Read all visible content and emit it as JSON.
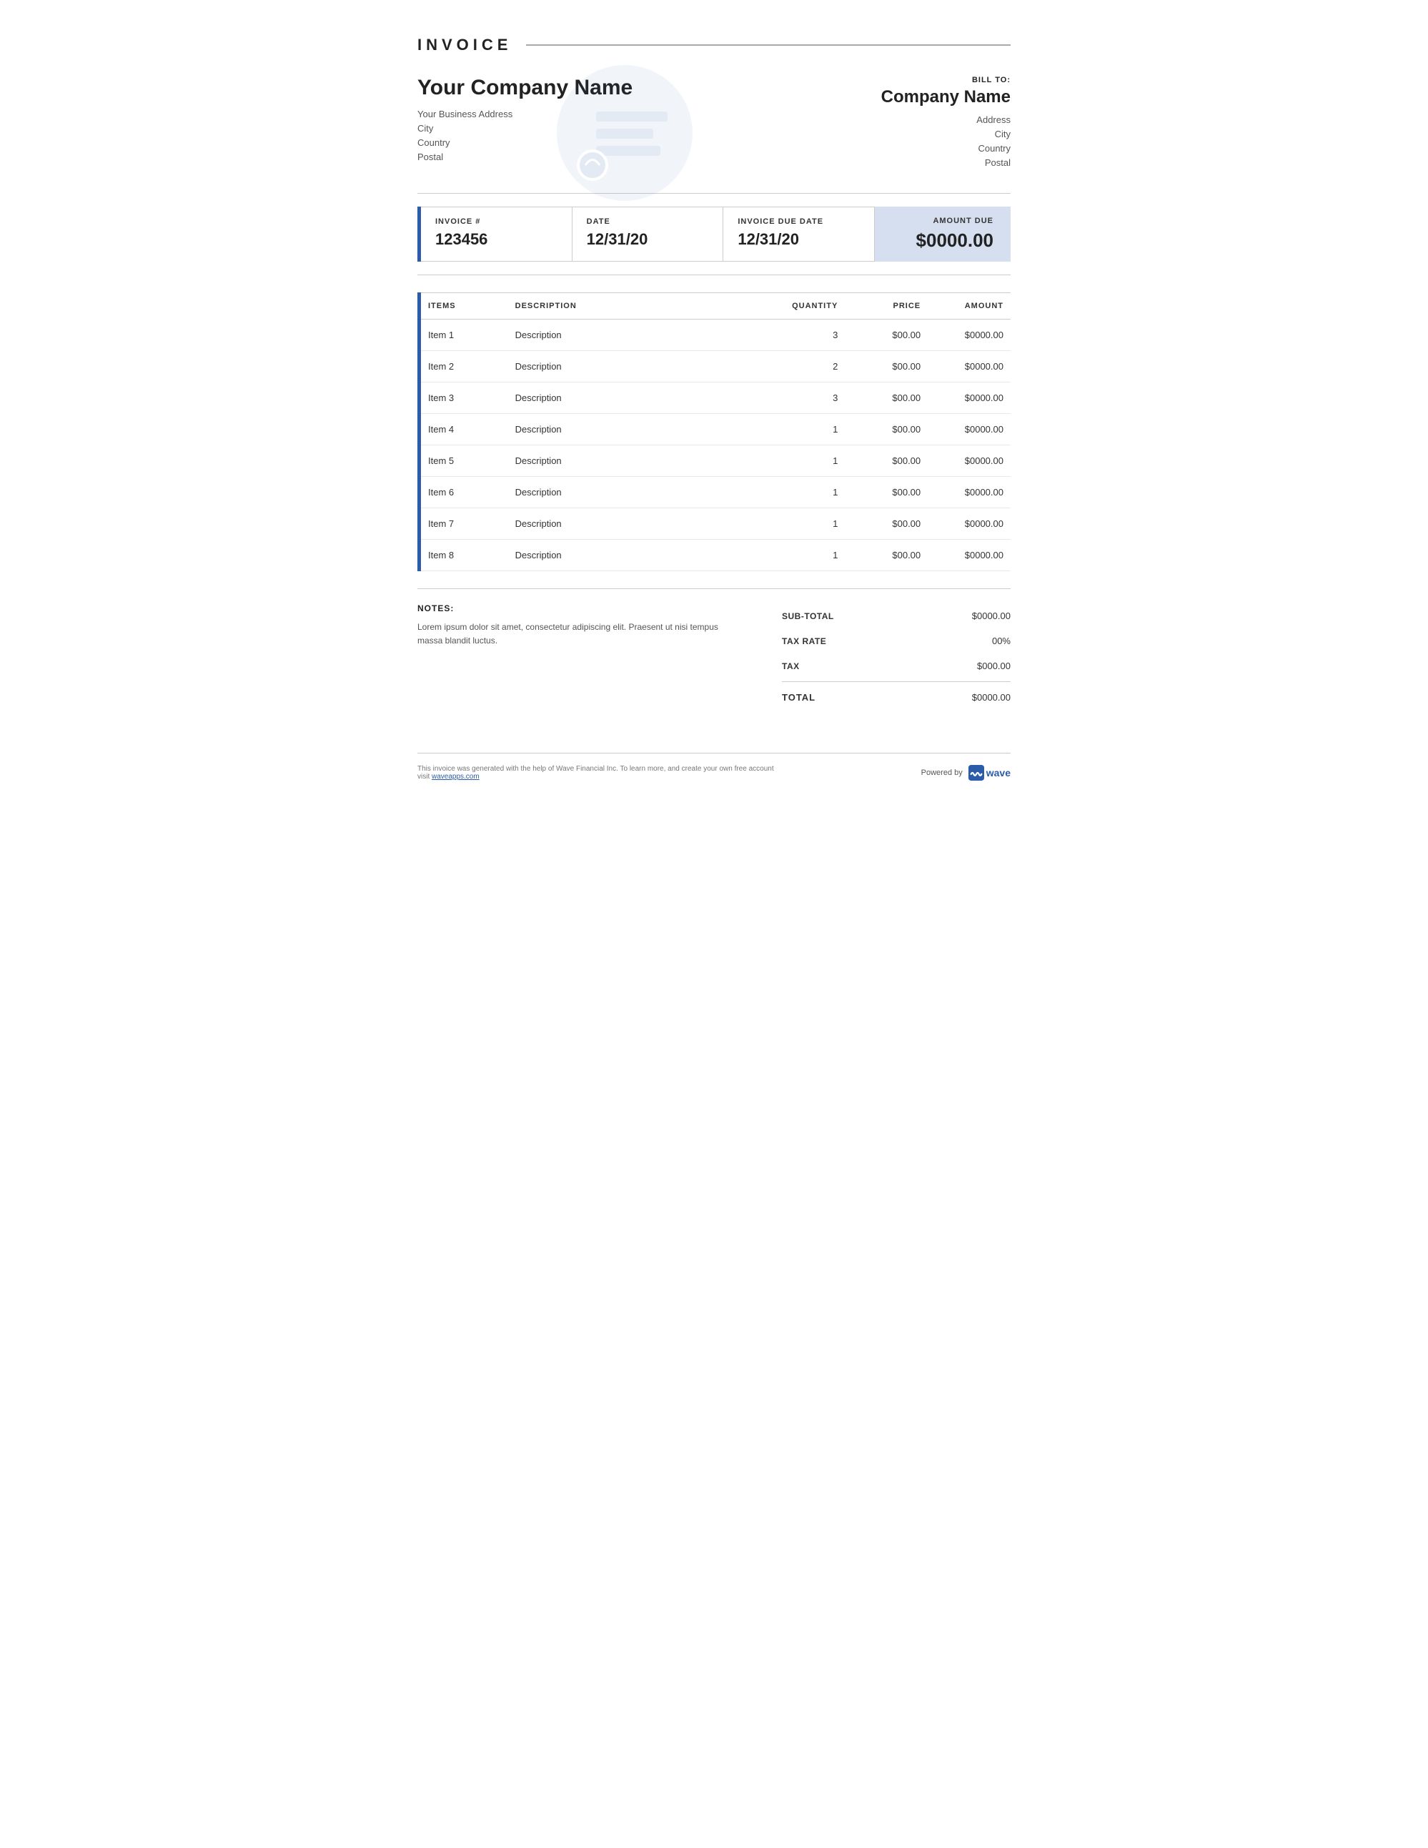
{
  "header": {
    "title": "INVOICE"
  },
  "company": {
    "name": "Your Company Name",
    "address": "Your Business Address",
    "city": "City",
    "country": "Country",
    "postal": "Postal"
  },
  "billTo": {
    "label": "BILL TO:",
    "name": "Company Name",
    "address": "Address",
    "city": "City",
    "country": "Country",
    "postal": "Postal"
  },
  "invoiceMeta": {
    "numberLabel": "INVOICE #",
    "number": "123456",
    "dateLabel": "DATE",
    "date": "12/31/20",
    "dueDateLabel": "INVOICE DUE DATE",
    "dueDate": "12/31/20",
    "amountDueLabel": "AMOUNT DUE",
    "amountDue": "$0000.00"
  },
  "itemsTable": {
    "headers": {
      "items": "ITEMS",
      "description": "DESCRIPTION",
      "quantity": "QUANTITY",
      "price": "PRICE",
      "amount": "AMOUNT"
    },
    "rows": [
      {
        "item": "Item 1",
        "description": "Description",
        "quantity": "3",
        "price": "$00.00",
        "amount": "$0000.00"
      },
      {
        "item": "Item 2",
        "description": "Description",
        "quantity": "2",
        "price": "$00.00",
        "amount": "$0000.00"
      },
      {
        "item": "Item 3",
        "description": "Description",
        "quantity": "3",
        "price": "$00.00",
        "amount": "$0000.00"
      },
      {
        "item": "Item 4",
        "description": "Description",
        "quantity": "1",
        "price": "$00.00",
        "amount": "$0000.00"
      },
      {
        "item": "Item 5",
        "description": "Description",
        "quantity": "1",
        "price": "$00.00",
        "amount": "$0000.00"
      },
      {
        "item": "Item 6",
        "description": "Description",
        "quantity": "1",
        "price": "$00.00",
        "amount": "$0000.00"
      },
      {
        "item": "Item 7",
        "description": "Description",
        "quantity": "1",
        "price": "$00.00",
        "amount": "$0000.00"
      },
      {
        "item": "Item 8",
        "description": "Description",
        "quantity": "1",
        "price": "$00.00",
        "amount": "$0000.00"
      }
    ]
  },
  "notes": {
    "label": "NOTES:",
    "text": "Lorem ipsum dolor sit amet, consectetur adipiscing elit. Praesent ut nisi tempus massa blandit luctus."
  },
  "totals": {
    "subTotalLabel": "SUB-TOTAL",
    "subTotalValue": "$0000.00",
    "taxRateLabel": "TAX RATE",
    "taxRateValue": "00%",
    "taxLabel": "TAX",
    "taxValue": "$000.00",
    "totalLabel": "TOTAL",
    "totalValue": "$0000.00"
  },
  "footer": {
    "text": "This invoice was generated with the help of Wave Financial Inc. To learn more, and create your own free account visit ",
    "linkText": "waveapps.com",
    "poweredBy": "Powered by",
    "waveBrand": "wave"
  }
}
